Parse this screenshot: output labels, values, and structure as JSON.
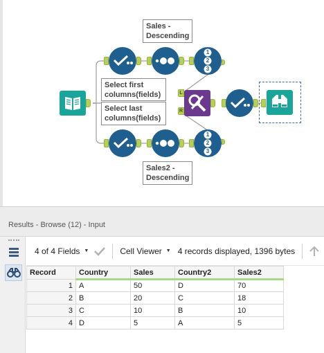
{
  "canvas": {
    "notes": {
      "sales_desc": "Sales -\nDescending",
      "select_first": "Select first\ncolumns(fields)",
      "select_last": "Select last\ncolumns(fields)",
      "sales2_desc": "Sales2 -\nDescending"
    },
    "anchor_labels": {
      "left": "L",
      "right": "R"
    },
    "sort_numbers": [
      "1",
      "2",
      "3"
    ],
    "colors": {
      "tool_blue": "#1f5f8f",
      "input_green": "#1aa59a",
      "join_purple": "#6b3a8e",
      "anchor": "#b6cf5a",
      "browse_border": "#3a6ea5"
    }
  },
  "results": {
    "header": "Results - Browse (12) - Input",
    "toolbar": {
      "fields_label": "4 of 4 Fields",
      "viewer_label": "Cell Viewer",
      "status": "4 records displayed, 1396 bytes"
    },
    "columns": [
      "Record",
      "Country",
      "Sales",
      "Country2",
      "Sales2"
    ],
    "rows": [
      [
        "1",
        "A",
        "50",
        "D",
        "70"
      ],
      [
        "2",
        "B",
        "20",
        "C",
        "18"
      ],
      [
        "3",
        "C",
        "10",
        "B",
        "10"
      ],
      [
        "4",
        "D",
        "5",
        "A",
        "5"
      ]
    ]
  },
  "icons": [
    "input-book-icon",
    "select-check-icon",
    "sample-dots-icon",
    "sort-123-icon",
    "join-pencil-icon",
    "browse-binoculars-icon",
    "list-icon",
    "binoculars-icon",
    "checkmark-icon",
    "up-arrow-icon"
  ]
}
